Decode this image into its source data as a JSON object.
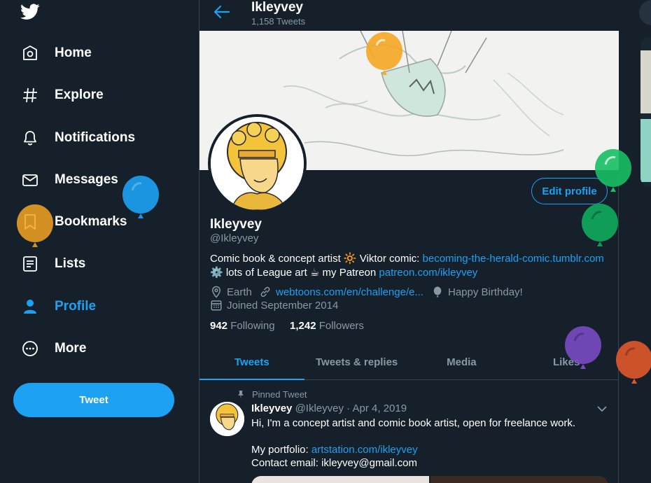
{
  "sidebar": {
    "items": [
      {
        "label": "Home",
        "icon": "home-icon"
      },
      {
        "label": "Explore",
        "icon": "hashtag-icon"
      },
      {
        "label": "Notifications",
        "icon": "bell-icon"
      },
      {
        "label": "Messages",
        "icon": "envelope-icon"
      },
      {
        "label": "Bookmarks",
        "icon": "bookmark-icon"
      },
      {
        "label": "Lists",
        "icon": "list-icon"
      },
      {
        "label": "Profile",
        "icon": "person-icon"
      },
      {
        "label": "More",
        "icon": "more-icon"
      }
    ],
    "tweet_button": "Tweet"
  },
  "header": {
    "name": "Ikleyvey",
    "tweet_count": "1,158 Tweets"
  },
  "profile": {
    "name": "Ikleyvey",
    "handle": "@Ikleyvey",
    "edit_button": "Edit profile",
    "bio": {
      "part1": "Comic book & concept artist 🔆 Viktor comic: ",
      "link1": "becoming-the-herald-comic.tumblr.com",
      "part2": " ⚙️ lots of League art ☕ my Patreon ",
      "link2": "patreon.com/ikleyvey"
    },
    "location": "Earth",
    "website": "webtoons.com/en/challenge/e...",
    "birthday": "Happy Birthday!",
    "joined": "Joined September 2014",
    "following_count": "942",
    "following_label": "Following",
    "followers_count": "1,242",
    "followers_label": "Followers"
  },
  "tabs": [
    "Tweets",
    "Tweets & replies",
    "Media",
    "Likes"
  ],
  "pinned_tweet": {
    "pinned_label": "Pinned Tweet",
    "author": "Ikleyvey",
    "handle": "@Ikleyvey",
    "separator": "·",
    "date": "Apr 4, 2019",
    "line1": "Hi, I'm a concept artist and comic book artist, open for freelance work.",
    "portfolio_label": "My portfolio: ",
    "portfolio_link": "artstation.com/ikleyvey",
    "contact": "Contact email: ikleyvey@gmail.com"
  },
  "colors": {
    "background": "#15202b",
    "accent": "#1da1f2",
    "muted": "#8899a6",
    "border": "#38444d",
    "balloons": [
      "#f5a623",
      "#1b95e0",
      "#f5a623",
      "#17bf63",
      "#0f9d58",
      "#794bc4",
      "#e0582a"
    ]
  }
}
